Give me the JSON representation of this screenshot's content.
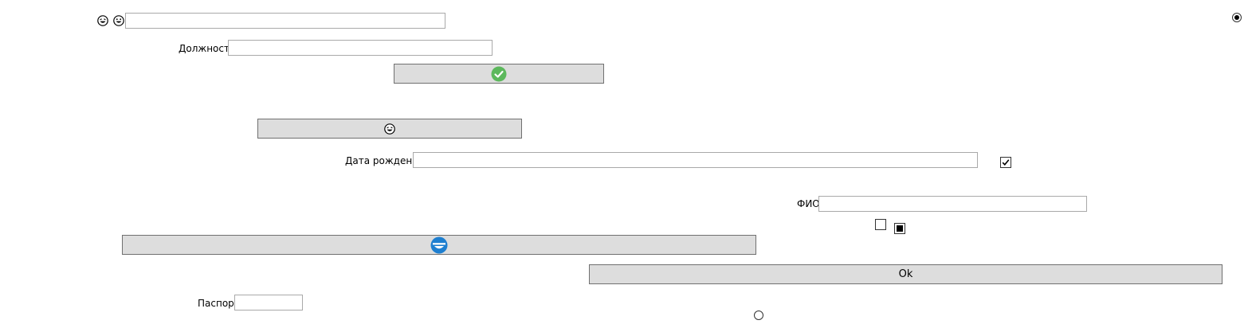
{
  "form": {
    "top_icons": [
      "laughing-tears-icon",
      "grinning-face-icon"
    ],
    "position_label": "Должность",
    "dob_label": "Дата рождения",
    "fio_label": "ФИО",
    "passport_label": "Паспорт",
    "ok_label": "Ok",
    "inputs": {
      "top_input": "",
      "position_input": "",
      "dob_input": "",
      "fio_input": "",
      "passport_input": ""
    },
    "confirm_button_icon": "green-check-icon",
    "emoji_button_icon": "laughing-tears-icon",
    "wide_button_icon": "blue-face-icon",
    "checkboxes": {
      "dob_checkbox": "checked",
      "left_checkbox": "unchecked",
      "right_checkbox": "indeterminate"
    },
    "radios": {
      "top_right_radio": "selected",
      "bottom_radio": "unselected"
    },
    "colors": {
      "button_bg": "#dddddd",
      "check_green": "#5cb85c",
      "blue_icon": "#1e7fd0"
    }
  }
}
